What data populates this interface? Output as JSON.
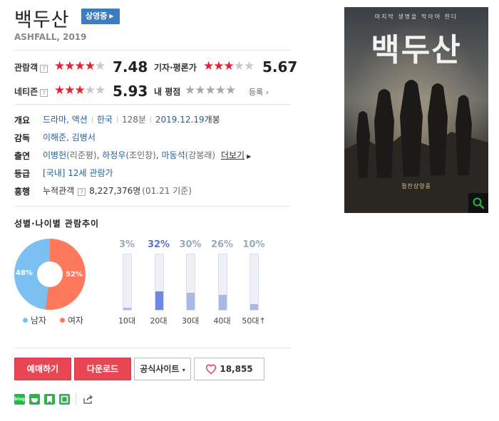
{
  "movie": {
    "title": "백두산",
    "status_badge": "상영중",
    "subtitle": "ASHFALL, 2019"
  },
  "ratings": {
    "audience": {
      "label": "관람객",
      "score": "7.48",
      "stars": 3.5
    },
    "critic": {
      "label": "기자·평론가",
      "score": "5.67",
      "stars": 2.5
    },
    "netizen": {
      "label": "네티즌",
      "score": "5.93",
      "stars": 3
    },
    "my": {
      "label": "내 평점",
      "register": "등록"
    }
  },
  "help_mark": "?",
  "info": {
    "summary_key": "개요",
    "genre": "드라마, 액션",
    "country": "한국",
    "runtime": "128분",
    "release_date": "2019.12.19",
    "release_suffix": "개봉",
    "director_key": "감독",
    "directors": "이해준, 김병서",
    "cast_key": "출연",
    "cast": [
      {
        "name": "이병헌",
        "role": "(리준평)"
      },
      {
        "name": "하정우",
        "role": "(조인창)"
      },
      {
        "name": "마동석",
        "role": "(강봉래)"
      }
    ],
    "cast_sep": ", ",
    "more": "더보기",
    "grade_key": "등급",
    "grade_prefix": "[국내]",
    "grade": "12세 관람가",
    "box_key": "흥행",
    "box_label": "누적관객",
    "box_value": "8,227,376명",
    "box_date": "(01.21 기준)"
  },
  "chart_data": [
    {
      "type": "pie",
      "title": "성별·나이별 관람추이",
      "categories": [
        "남자",
        "여자"
      ],
      "values": [
        48,
        52
      ],
      "value_labels": [
        "48%",
        "52%"
      ],
      "colors": [
        "#7cc0f2",
        "#ff7a5c"
      ]
    },
    {
      "type": "bar",
      "categories": [
        "10대",
        "20대",
        "30대",
        "40대",
        "50대↑"
      ],
      "values": [
        3,
        32,
        30,
        26,
        10
      ],
      "value_labels": [
        "3%",
        "32%",
        "30%",
        "26%",
        "10%"
      ],
      "highlight": "20대",
      "ylim": [
        0,
        100
      ]
    }
  ],
  "actions": {
    "reserve": "예매하기",
    "download": "다운로드",
    "official": "공식사이트",
    "like_count": "18,855"
  },
  "sns": [
    {
      "name": "blog",
      "label": "blog",
      "color": "#2fb24a"
    },
    {
      "name": "cafe",
      "label": "",
      "color": "#2fb24a"
    },
    {
      "name": "bookmark",
      "label": "",
      "color": "#2fb24a"
    },
    {
      "name": "memo",
      "label": "",
      "color": "#2fb24a"
    }
  ],
  "poster": {
    "top_text": "마지막 생명을 막아야 한다",
    "title": "백두산",
    "bottom_text": "절찬상영중"
  },
  "colors": {
    "accent_red": "#e84653",
    "link_blue": "#1f5fa6",
    "badge_blue": "#3e7cc2",
    "star_red": "#e8212f"
  }
}
